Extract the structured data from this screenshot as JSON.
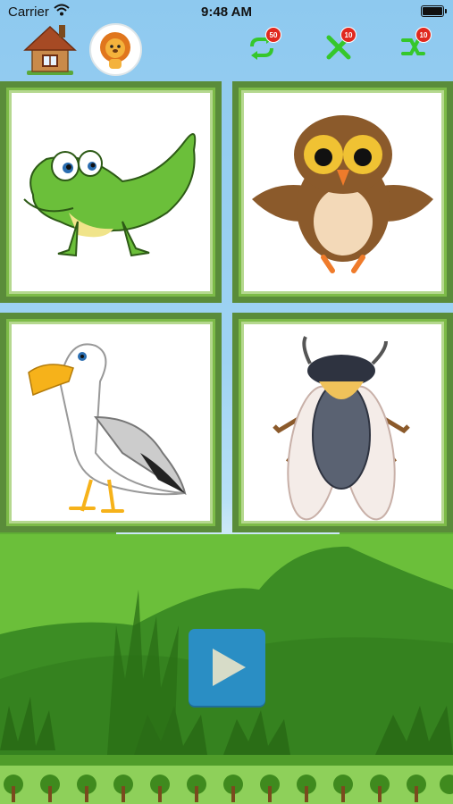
{
  "status_bar": {
    "carrier": "Carrier",
    "time": "9:48 AM"
  },
  "toolbar": {
    "home_icon": "house-icon",
    "avatar_icon": "lion-icon",
    "replay_count": "50",
    "mistake_count": "10",
    "skip_count": "10"
  },
  "cards": [
    {
      "animal": "crocodile"
    },
    {
      "animal": "owl"
    },
    {
      "animal": "seagull"
    },
    {
      "animal": "cicada"
    }
  ],
  "play_button": {
    "icon": "play-icon",
    "color": "#2a8ec4"
  },
  "colors": {
    "sky": "#9fd3f4",
    "grass": "#6bbf3a",
    "card_border": "#5a8c3a"
  }
}
